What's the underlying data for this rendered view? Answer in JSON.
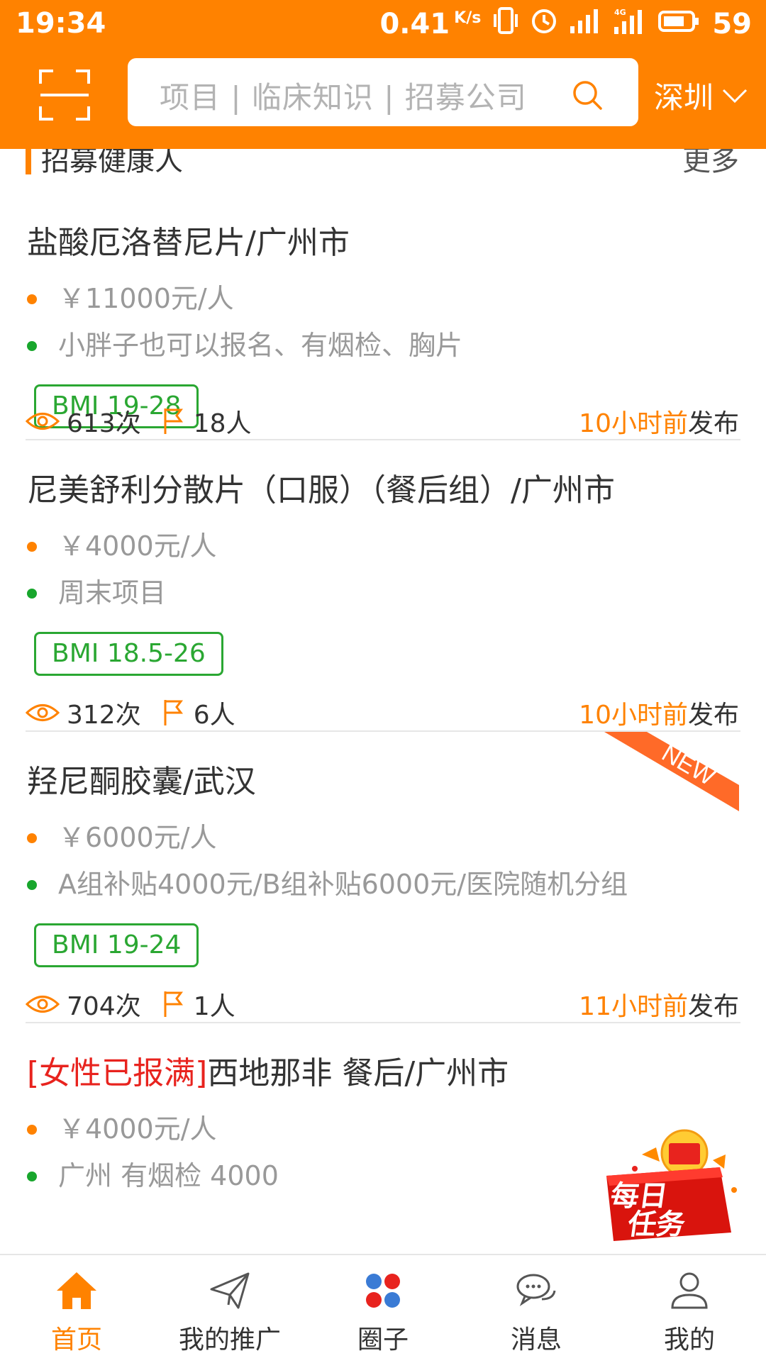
{
  "status_bar": {
    "time": "19:34",
    "speed": "0.41",
    "speed_unit": "K/s",
    "network": "4G",
    "battery": "59"
  },
  "header": {
    "search_placeholder": "项目 | 临床知识 | 招募公司",
    "city": "深圳",
    "accent_color": "#ff8200"
  },
  "section": {
    "title": "招募健康人",
    "more": "更多"
  },
  "projects": [
    {
      "flag": "",
      "title": "盐酸厄洛替尼片/广州市",
      "price": "￥11000元/人",
      "note": "小胖子也可以报名、有烟检、胸片",
      "bmi": "BMI 19-28",
      "views": "613次",
      "signups": "18人",
      "posted_ago": "10小时前",
      "posted_suffix": "发布",
      "is_new": false
    },
    {
      "flag": "",
      "title": "尼美舒利分散片（口服）（餐后组）/广州市",
      "price": "￥4000元/人",
      "note": "周末项目",
      "bmi": "BMI 18.5-26",
      "views": "312次",
      "signups": "6人",
      "posted_ago": "10小时前",
      "posted_suffix": "发布",
      "is_new": false
    },
    {
      "flag": "",
      "title": "羟尼酮胶囊/武汉",
      "price": "￥6000元/人",
      "note": "A组补贴4000元/B组补贴6000元/医院随机分组",
      "bmi": "BMI 19-24",
      "views": "704次",
      "signups": "1人",
      "posted_ago": "11小时前",
      "posted_suffix": "发布",
      "is_new": true,
      "new_label": "NEW"
    },
    {
      "flag": "[女性已报满]",
      "title": "西地那非 餐后/广州市",
      "price": "￥4000元/人",
      "note": "广州 有烟检 4000",
      "bmi": "",
      "views": "",
      "signups": "",
      "posted_ago": "",
      "posted_suffix": "",
      "is_new": false
    }
  ],
  "daily_task": {
    "line1": "每日",
    "line2": "任务"
  },
  "bottom_nav": [
    {
      "label": "首页",
      "icon": "home-icon",
      "active": true
    },
    {
      "label": "我的推广",
      "icon": "paper-plane-icon",
      "active": false
    },
    {
      "label": "圈子",
      "icon": "circles-icon",
      "active": false
    },
    {
      "label": "消息",
      "icon": "chat-icon",
      "active": false
    },
    {
      "label": "我的",
      "icon": "user-icon",
      "active": false
    }
  ]
}
